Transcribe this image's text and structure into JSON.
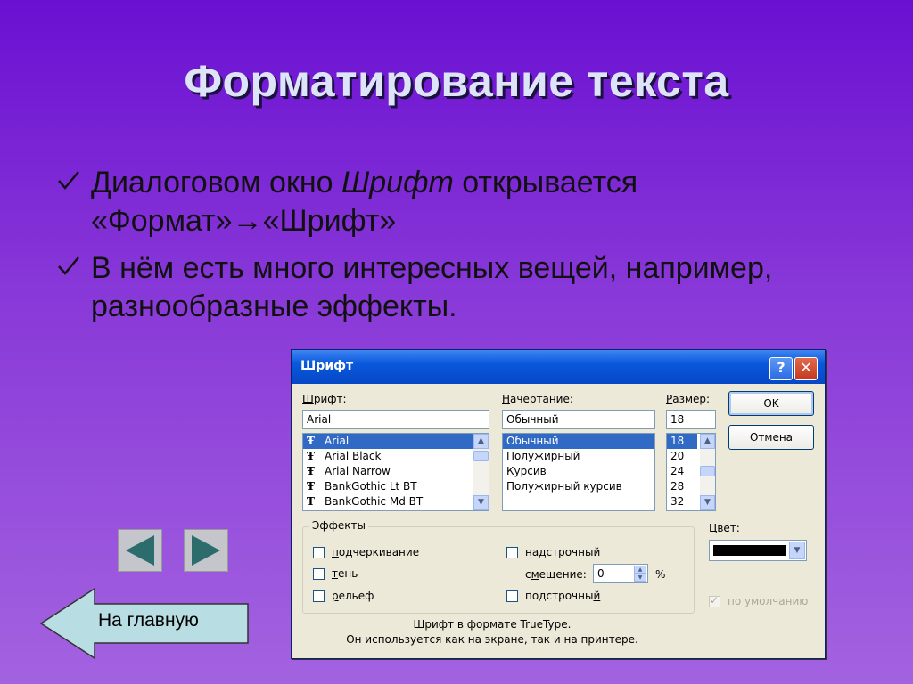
{
  "slide": {
    "title": "Форматирование текста",
    "bullets": [
      {
        "before": "Диалоговом окно ",
        "italic": "Шрифт",
        "after": " открывается «Формат»→«Шрифт»"
      },
      {
        "before": "В нём есть много интересных вещей, например, разнообразные эффекты.",
        "italic": "",
        "after": ""
      }
    ]
  },
  "dialog": {
    "title": "Шрифт",
    "help_label": "?",
    "close_label": "✕",
    "font": {
      "label_u": "Ш",
      "label_rest": "рифт:",
      "value": "Arial",
      "items": [
        "Arial",
        "Arial Black",
        "Arial Narrow",
        "BankGothic Lt BT",
        "BankGothic Md BT"
      ],
      "selected": "Arial"
    },
    "style": {
      "label_u": "Н",
      "label_rest": "ачертание:",
      "value": "Обычный",
      "items": [
        "Обычный",
        "Полужирный",
        "Курсив",
        "Полужирный курсив"
      ],
      "selected": "Обычный"
    },
    "size": {
      "label_u": "Р",
      "label_rest": "азмер:",
      "value": "18",
      "items": [
        "18",
        "20",
        "24",
        "28",
        "32"
      ],
      "selected": "18"
    },
    "ok_label": "OK",
    "cancel_label": "Отмена",
    "effects": {
      "title": "Эффекты",
      "underline": {
        "u": "п",
        "rest": "одчеркивание"
      },
      "shadow": {
        "u": "т",
        "rest": "ень"
      },
      "relief": {
        "u": "р",
        "rest": "ельеф"
      },
      "superscript": {
        "pre": "на",
        "u": "д",
        "rest": "строчный"
      },
      "offset": {
        "pre": "с",
        "u": "м",
        "rest": "ещение:"
      },
      "offset_value": "0",
      "offset_unit": "%",
      "subscript": {
        "pre": "подстрочны",
        "u": "й",
        "rest": ""
      }
    },
    "color": {
      "label_u": "Ц",
      "label_rest": "вет:",
      "swatch": "#000000",
      "default_label": "по умолчанию"
    },
    "footer_line1": "Шрифт в формате TrueType.",
    "footer_line2": "Он используется как на экране, так и на принтере."
  },
  "nav": {
    "home_label": "На главную"
  },
  "colors": {
    "accent_blue": "#0548c6",
    "selection": "#316ac5",
    "nav_arrow": "#2c6c6c",
    "home_fill": "#b8dde2"
  }
}
